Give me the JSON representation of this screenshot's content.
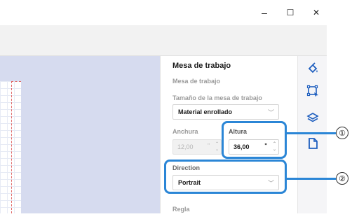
{
  "window": {
    "minimize_glyph": "–",
    "maximize_glyph": "☐",
    "close_glyph": "✕"
  },
  "panel": {
    "title": "Mesa de trabajo",
    "section": "Mesa de trabajo",
    "mat_size_label": "Tamaño de la mesa de trabajo",
    "mat_size_value": "Material enrollado",
    "width_label": "Anchura",
    "width_value": "12,00",
    "height_label": "Altura",
    "height_value": "36,00",
    "unit": "\"",
    "direction_label": "Direction",
    "direction_value": "Portrait",
    "ruler_label": "Regla"
  },
  "callouts": [
    {
      "number": "①",
      "target": "Altura"
    },
    {
      "number": "②",
      "target": "Direction"
    }
  ],
  "icons": {
    "side": [
      "paint-bucket-icon",
      "crop-select-icon",
      "layers-icon",
      "document-icon"
    ],
    "active": "document-icon",
    "accent": "#1f5fbf",
    "callout_color": "#2b86d6"
  }
}
